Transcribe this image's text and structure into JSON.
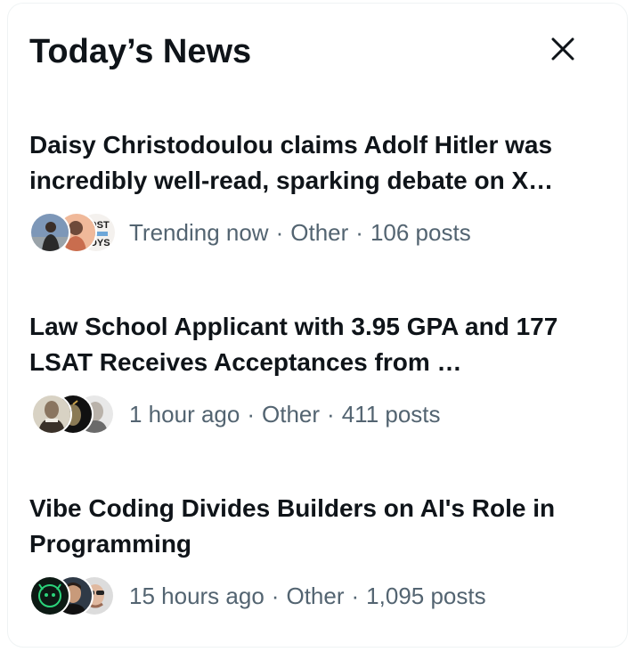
{
  "panel": {
    "title": "Today’s News",
    "close_icon": "close-icon"
  },
  "news": [
    {
      "headline": "Daisy Christodoulou claims Adolf Hitler was incredibly well-read, sparking debate on X…",
      "time": "Trending now",
      "category": "Other",
      "posts": "106 posts",
      "avatar_text": [
        "LOST",
        "BOYS"
      ]
    },
    {
      "headline": "Law School Applicant with 3.95 GPA and 177 LSAT Receives Acceptances from …",
      "time": "1 hour ago",
      "category": "Other",
      "posts": "411 posts"
    },
    {
      "headline": "Vibe Coding Divides Builders on AI's Role in Programming",
      "time": "15 hours ago",
      "category": "Other",
      "posts": "1,095 posts"
    }
  ],
  "separator": "·"
}
